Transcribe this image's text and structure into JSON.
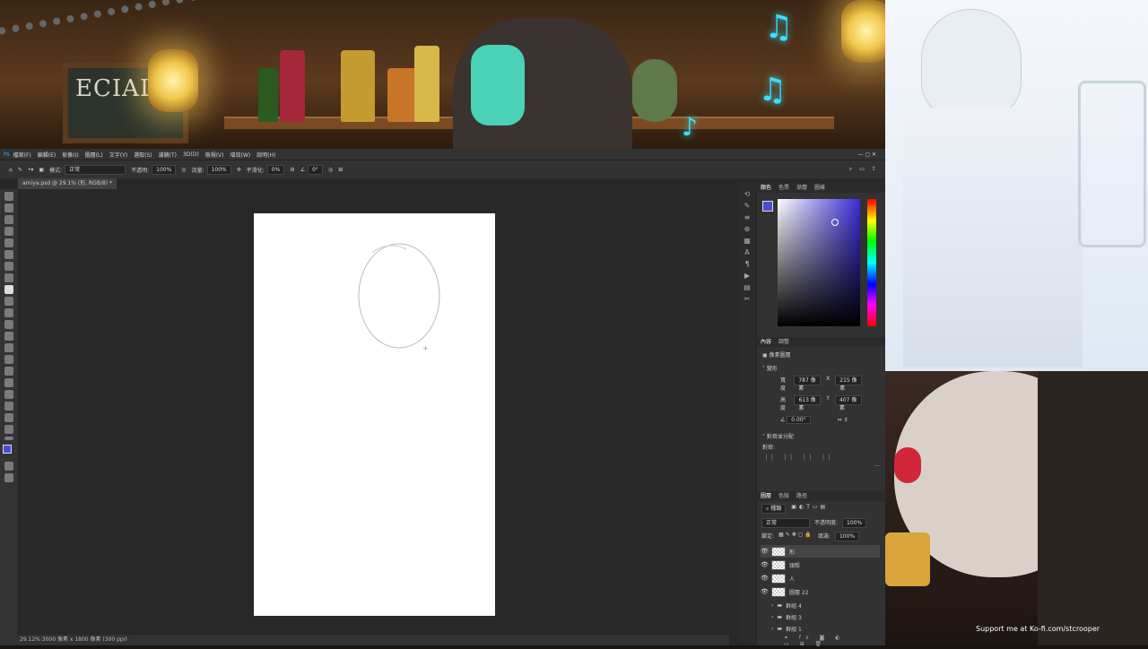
{
  "stream": {
    "chalkboard_text": "ECIAL",
    "kofi_text": "Support me at Ko-fi.com/stcrooper"
  },
  "photoshop": {
    "menu": [
      "檔案(F)",
      "編輯(E)",
      "影像(I)",
      "圖層(L)",
      "文字(Y)",
      "選取(S)",
      "濾鏡(T)",
      "3D(D)",
      "檢視(V)",
      "增效(W)",
      "說明(H)"
    ],
    "options": {
      "mode_label": "模式:",
      "mode_value": "正常",
      "opacity_label": "不透明:",
      "opacity_value": "100%",
      "flow_label": "流量:",
      "flow_value": "100%",
      "smooth_label": "平滑化:",
      "smooth_value": "0%",
      "angle_value": "0°"
    },
    "doc_tab": "amiya.psd @ 29.1% (形, RGB/8) *",
    "status": "29.12%   3000 像素 x 1800 像素 (300 ppi)",
    "color_tabs": [
      "顏色",
      "色票",
      "漸層",
      "圖樣"
    ],
    "properties": {
      "tabs": [
        "內容",
        "調整"
      ],
      "pixel_layer": "像素圖層",
      "transform_title": "變形",
      "w_label": "寬度",
      "w_value": "787 像素",
      "x_label": "X",
      "x_value": "215 像素",
      "h_label": "高度",
      "h_value": "613 像素",
      "y_label": "Y",
      "y_value": "407 像素",
      "angle": "0.00°",
      "align_title": "對齊並分配",
      "align_label": "對齊:"
    },
    "layers_panel": {
      "tabs": [
        "圖層",
        "色版",
        "路徑"
      ],
      "kind": "種類",
      "blend": "正常",
      "opacity_label": "不透明度:",
      "opacity_value": "100%",
      "lock_label": "鎖定:",
      "fill_label": "填滿:",
      "fill_value": "100%",
      "layers": [
        {
          "name": "形",
          "visible": true,
          "type": "pixel"
        },
        {
          "name": "頭殼",
          "visible": true,
          "type": "pixel"
        },
        {
          "name": "人",
          "visible": true,
          "type": "pixel"
        },
        {
          "name": "圖層 22",
          "visible": true,
          "type": "pixel"
        },
        {
          "name": "群組 4",
          "visible": false,
          "type": "group"
        },
        {
          "name": "群組 3",
          "visible": false,
          "type": "group"
        },
        {
          "name": "群組 1",
          "visible": false,
          "type": "group"
        }
      ]
    },
    "colors": {
      "foreground": "#4b4bd9",
      "accent": "#3a2cd6"
    }
  }
}
